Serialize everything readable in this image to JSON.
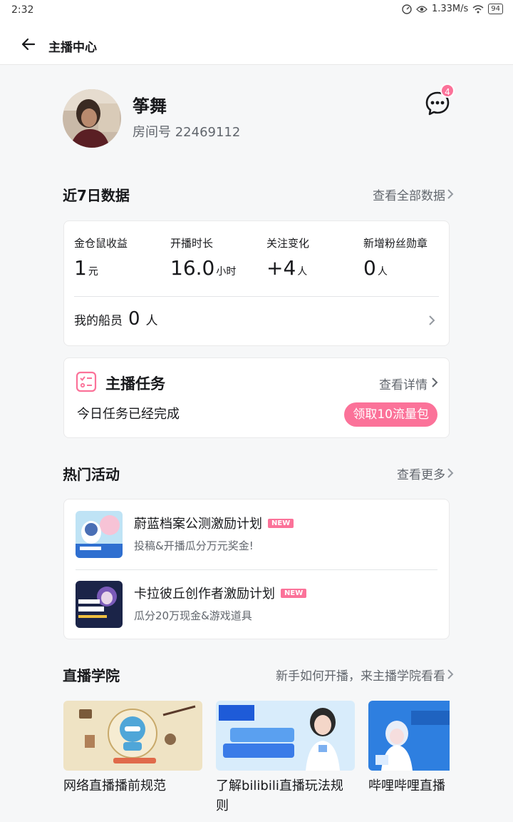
{
  "status": {
    "time": "2:32",
    "net": "1.33M/s",
    "battery": "94"
  },
  "topbar": {
    "title": "主播中心"
  },
  "profile": {
    "name": "筝舞",
    "room": "房间号 22469112",
    "msg_count": "4"
  },
  "data7": {
    "title": "近7日数据",
    "more": "查看全部数据",
    "stats": [
      {
        "label": "金仓鼠收益",
        "value": "1",
        "unit": "元"
      },
      {
        "label": "开播时长",
        "value": "16.0",
        "unit": "小时"
      },
      {
        "label": "关注变化",
        "value": "+4",
        "unit": "人"
      },
      {
        "label": "新增粉丝勋章",
        "value": "0",
        "unit": "人"
      }
    ],
    "crew_label": "我的船员",
    "crew_value": "0",
    "crew_unit": "人"
  },
  "task": {
    "title": "主播任务",
    "more": "查看详情",
    "status": "今日任务已经完成",
    "button": "领取10流量包"
  },
  "hot": {
    "title": "热门活动",
    "more": "查看更多",
    "items": [
      {
        "title": "蔚蓝档案公测激励计划",
        "badge": "NEW",
        "sub": "投稿&开播瓜分万元奖金!"
      },
      {
        "title": "卡拉彼丘创作者激励计划",
        "badge": "NEW",
        "sub": "瓜分20万现金&游戏道具"
      }
    ]
  },
  "academy": {
    "title": "直播学院",
    "more": "新手如何开播，来主播学院看看",
    "courses": [
      {
        "title": "网络直播播前规范"
      },
      {
        "title": "了解bilibili直播玩法规则"
      },
      {
        "title": "哔哩哔哩直播"
      }
    ]
  },
  "colors": {
    "accent": "#fb7299",
    "bg": "#f6f7f8",
    "text": "#18191c",
    "muted": "#61666d"
  }
}
